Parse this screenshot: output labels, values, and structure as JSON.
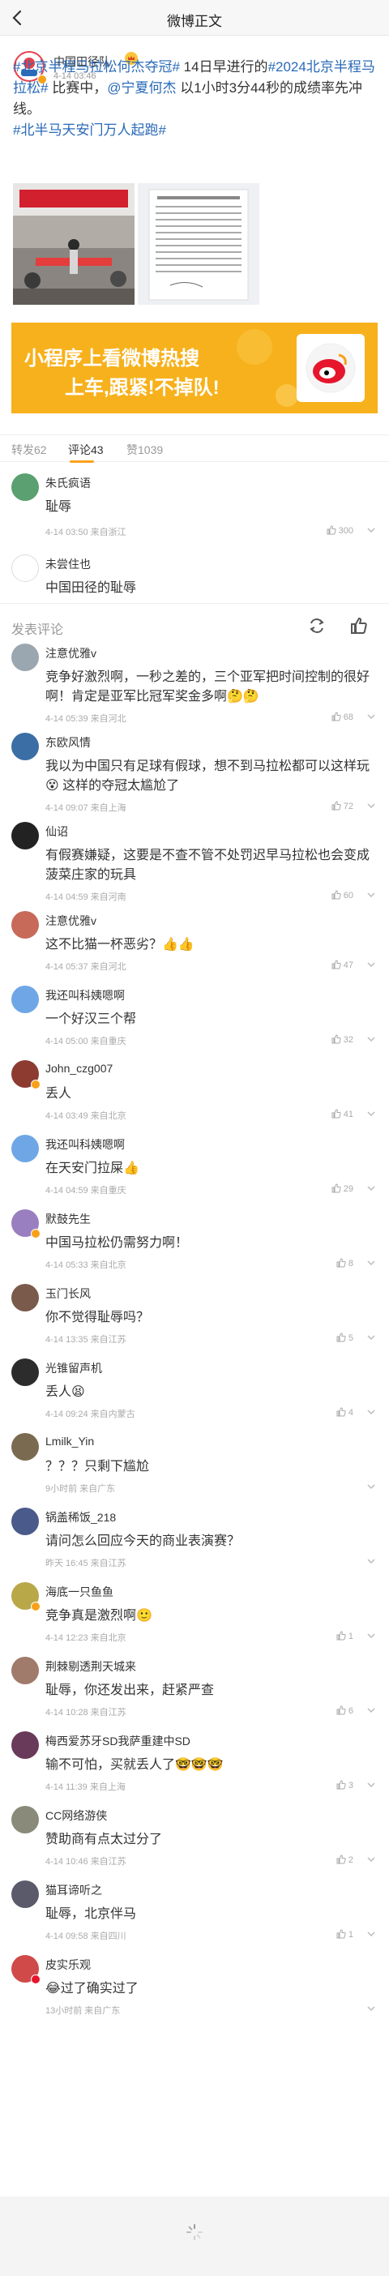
{
  "nav": {
    "title": "微博正文"
  },
  "post": {
    "author": "中国田径队",
    "time": "4-14 03:46",
    "topic1": "#北京半程马拉松何杰夺冠#",
    "text1": " 14日早进行的",
    "topic2": "#2024北京半程马拉松#",
    "text2": " 比赛中，",
    "mention": "@宁夏何杰",
    "text3": " 以1小时3分44秒的成绩率先冲线。",
    "topic3": "#北半马天安门万人起跑#"
  },
  "banner": {
    "line1": "小程序上看微博热搜",
    "line2": "上车,跟紧!不掉队!"
  },
  "tabs": {
    "repost": "转发62",
    "comment": "评论43",
    "like": "赞1039"
  },
  "compose": {
    "placeholder": "发表评论"
  },
  "top_comments": [
    {
      "name": "朱氏疯语",
      "text": "耻辱",
      "meta": "4-14 03:50 来自浙江",
      "likes": "300"
    },
    {
      "name": "未尝住也",
      "text": "中国田径的耻辱",
      "meta": "",
      "likes": ""
    }
  ],
  "comments": [
    {
      "name": "注意优雅v",
      "text": "竞争好激烈啊，一秒之差的，三个亚军把时间控制的很好啊！肯定是亚军比冠军奖金多啊🤔🤔",
      "meta": "4-14 05:39 来自河北",
      "likes": "68"
    },
    {
      "name": "东欧风情",
      "text": "我以为中国只有足球有假球，想不到马拉松都可以这样玩😵 这样的夺冠太尴尬了",
      "meta": "4-14 09:07 来自上海",
      "likes": "72"
    },
    {
      "name": "仙诏",
      "text": "有假赛嫌疑，这要是不查不管不处罚迟早马拉松也会变成菠菜庄家的玩具",
      "meta": "4-14 04:59 来自河南",
      "likes": "60"
    },
    {
      "name": "注意优雅v",
      "text": "这不比猫一杯恶劣？👍👍",
      "meta": "4-14 05:37 来自河北",
      "likes": "47"
    },
    {
      "name": "我还叫科姨嗯啊",
      "text": "一个好汉三个帮",
      "meta": "4-14 05:00 来自重庆",
      "likes": "32"
    },
    {
      "name": "John_czg007",
      "text": "丢人",
      "meta": "4-14 03:49 来自北京",
      "likes": "41"
    },
    {
      "name": "我还叫科姨嗯啊",
      "text": "在天安门拉屎👍",
      "meta": "4-14 04:59 来自重庆",
      "likes": "29"
    },
    {
      "name": "默鼓先生",
      "text": "中国马拉松仍需努力啊！",
      "meta": "4-14 05:33 来自北京",
      "likes": "8"
    },
    {
      "name": "玉门长风",
      "text": "你不觉得耻辱吗？",
      "meta": "4-14 13:35 来自江苏",
      "likes": "5"
    },
    {
      "name": "光锥留声机",
      "text": "丢人😫",
      "meta": "4-14 09:24 来自内蒙古",
      "likes": "4"
    },
    {
      "name": "Lmilk_Yin",
      "text": "？？？只剩下尴尬",
      "meta": "9小时前 来自广东",
      "likes": ""
    },
    {
      "name": "锅盖稀饭_218",
      "text": "请问怎么回应今天的商业表演赛？",
      "meta": "昨天 16:45 来自江苏",
      "likes": ""
    },
    {
      "name": "海底一只鱼鱼",
      "text": "竞争真是激烈啊🙂",
      "meta": "4-14 12:23 来自北京",
      "likes": "1"
    },
    {
      "name": "荆棘剔透荆天城来",
      "text": "耻辱，你还发出来，赶紧严查",
      "meta": "4-14 10:28 来自江苏",
      "likes": "6"
    },
    {
      "name": "梅西爱苏牙SD我萨重建中SD",
      "text": "输不可怕，买就丢人了🤓🤓🤓",
      "meta": "4-14 11:39 来自上海",
      "likes": "3"
    },
    {
      "name": "CC网络游侠",
      "text": "赞助商有点太过分了",
      "meta": "4-14 10:46 来自江苏",
      "likes": "2"
    },
    {
      "name": "猫耳谛听之",
      "text": "耻辱，北京伴马",
      "meta": "4-14 09:58 来自四川",
      "likes": "1"
    },
    {
      "name": "皮实乐观",
      "text": "😂过了确实过了",
      "meta": "13小时前 来自广东",
      "likes": ""
    }
  ],
  "colors": {
    "accent": "#f9a21a",
    "link": "#2a6ab8",
    "banner": "#f7b11c"
  }
}
